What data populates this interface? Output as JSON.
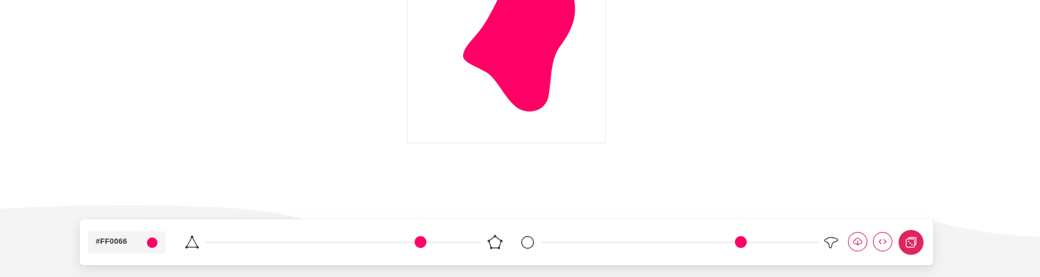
{
  "colors": {
    "accent": "#FF0066",
    "button_red": "#E0245E",
    "track": "#ECECEC"
  },
  "blob": {
    "fill": "#FF0066"
  },
  "toolbar": {
    "color_picker": {
      "value": "#FF0066"
    },
    "complexity": {
      "min_icon": "triangle-nodes-icon",
      "max_icon": "pentagon-nodes-icon",
      "value": 0.78
    },
    "randomness": {
      "min_icon": "circle-icon",
      "max_icon": "irregular-blob-icon",
      "value": 0.72
    },
    "buttons": [
      {
        "name": "download-button",
        "icon": "download-icon"
      },
      {
        "name": "code-button",
        "icon": "code-icon"
      },
      {
        "name": "randomize-button",
        "icon": "dice-icon"
      }
    ]
  }
}
